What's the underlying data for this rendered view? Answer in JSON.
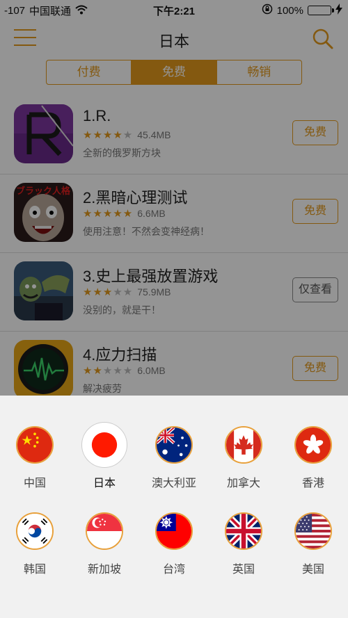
{
  "status": {
    "signal": "-107",
    "carrier": "中国联通",
    "time": "下午2:21",
    "battery": "100%"
  },
  "nav": {
    "title": "日本"
  },
  "tabs": [
    {
      "label": "付费"
    },
    {
      "label": "免费"
    },
    {
      "label": "畅销"
    }
  ],
  "apps": [
    {
      "name": "1.R.",
      "size": "45.4MB",
      "stars": 4,
      "desc": "全新的俄罗斯方块",
      "button": "免费"
    },
    {
      "name": "2.黑暗心理测试",
      "size": "6.6MB",
      "stars": 5,
      "desc": "使用注意！不然会变神经病！",
      "button": "免费",
      "icon_text": "ブラック人格"
    },
    {
      "name": "3.史上最强放置游戏",
      "size": "75.9MB",
      "stars": 3,
      "desc": "没别的，就是干！",
      "button": "仅查看"
    },
    {
      "name": "4.应力扫描",
      "size": "6.0MB",
      "stars": 2,
      "desc": "解决疲劳",
      "button": "免费"
    }
  ],
  "countries": [
    {
      "label": "中国"
    },
    {
      "label": "日本"
    },
    {
      "label": "澳大利亚"
    },
    {
      "label": "加拿大"
    },
    {
      "label": "香港"
    },
    {
      "label": "韩国"
    },
    {
      "label": "新加坡"
    },
    {
      "label": "台湾"
    },
    {
      "label": "英国"
    },
    {
      "label": "美国"
    }
  ],
  "colors": {
    "accent": "#e39a1d"
  }
}
